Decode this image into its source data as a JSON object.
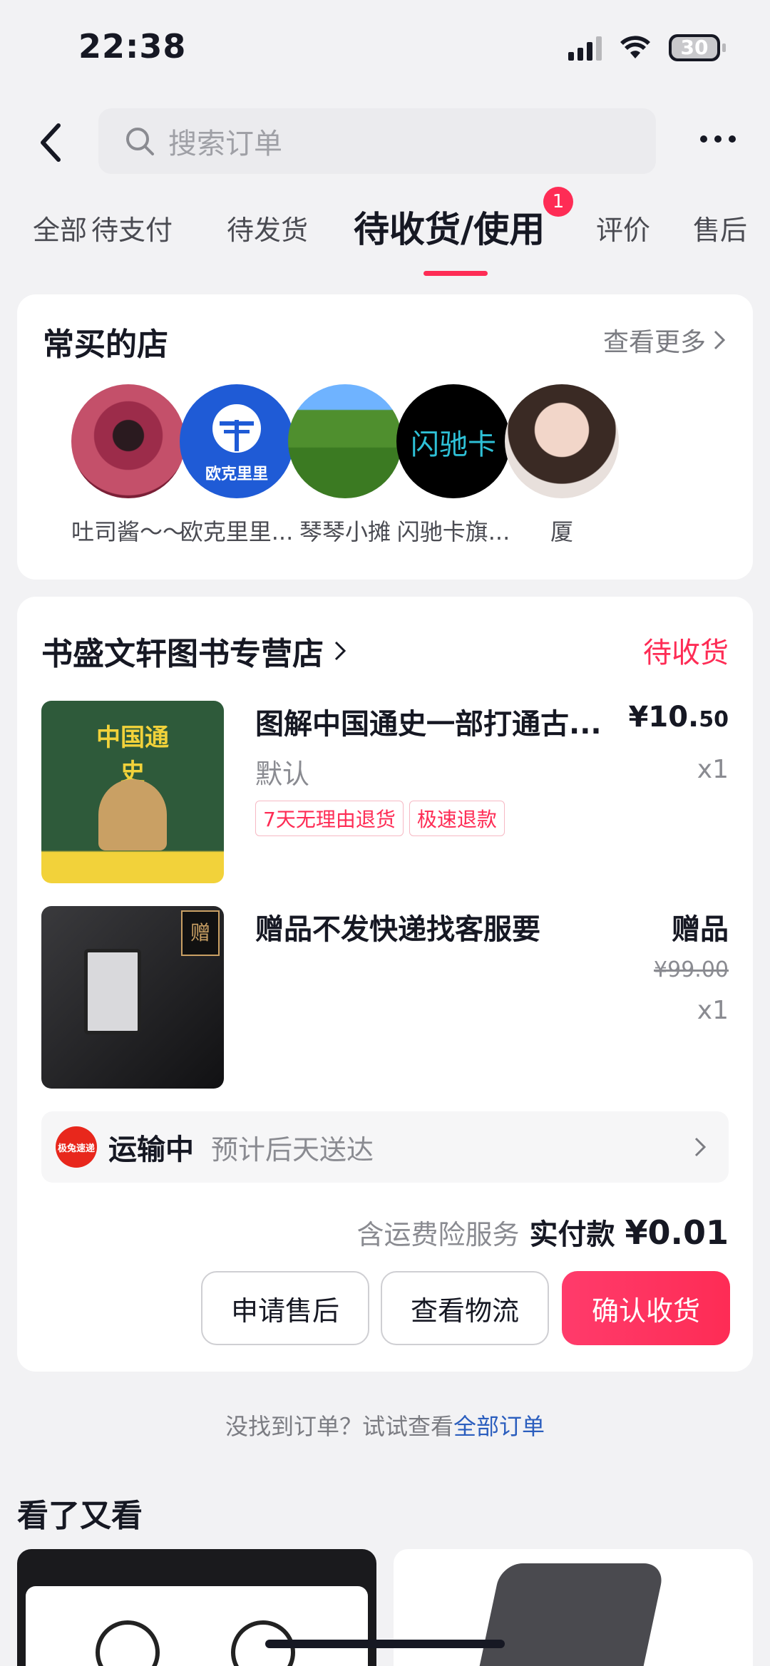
{
  "status_bar": {
    "time": "22:38",
    "battery": "30"
  },
  "search": {
    "placeholder": "搜索订单"
  },
  "tabs": [
    {
      "label": "全部"
    },
    {
      "label": "待支付"
    },
    {
      "label": "待发货"
    },
    {
      "label": "待收货/使用",
      "active": true,
      "badge": "1"
    },
    {
      "label": "评价"
    },
    {
      "label": "售后"
    }
  ],
  "frequent_shops": {
    "title": "常买的店",
    "see_more": "查看更多",
    "shops": [
      {
        "name": "吐司酱〜〜"
      },
      {
        "name": "欧克里里...",
        "logo_text": "欧克里里"
      },
      {
        "name": "琴琴小摊"
      },
      {
        "name": "闪驰卡旗...",
        "logo_text": "闪驰卡"
      },
      {
        "name": "厦"
      }
    ]
  },
  "order": {
    "store_name": "书盛文轩图书专营店",
    "status": "待收货",
    "items": [
      {
        "title": "图解中国通史一部打通古...",
        "spec": "默认",
        "price_main": "¥10.",
        "price_cents": "50",
        "qty": "x1",
        "tags": [
          "7天无理由退货",
          "极速退款"
        ]
      },
      {
        "title": "赠品不发快递找客服要",
        "gift_label": "赠品",
        "orig_price": "¥99.00",
        "qty": "x1"
      }
    ],
    "logistics": {
      "courier_logo": "极兔速递",
      "status": "运输中",
      "eta": "预计后天送达"
    },
    "insurance": "含运费险服务",
    "paid_label": "实付款",
    "paid_amount": "¥0.01",
    "buttons": {
      "after_sale": "申请售后",
      "view_logistics": "查看物流",
      "confirm": "确认收货"
    }
  },
  "not_found": {
    "text": "没找到订单？试试查看",
    "link": "全部订单"
  },
  "recommend": {
    "title": "看了又看"
  },
  "colors": {
    "accent": "#fe2c55",
    "link": "#2b5ebe",
    "background": "#f2f2f4"
  }
}
